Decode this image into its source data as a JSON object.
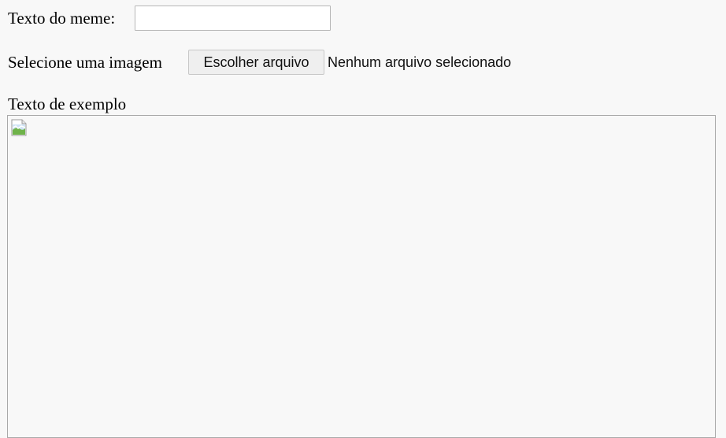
{
  "form": {
    "meme_text_label": "Texto do meme:",
    "meme_text_value": "",
    "image_select_label": "Selecione uma imagem",
    "choose_file_button": "Escolher arquivo",
    "no_file_status": "Nenhum arquivo selecionado"
  },
  "preview": {
    "example_text": "Texto de exemplo",
    "image_icon": "broken-image-icon"
  },
  "colors": {
    "page_background": "#f8f8f8",
    "input_border": "#b6b6b6",
    "button_background": "#efefef",
    "frame_border": "#a9a9a9"
  }
}
